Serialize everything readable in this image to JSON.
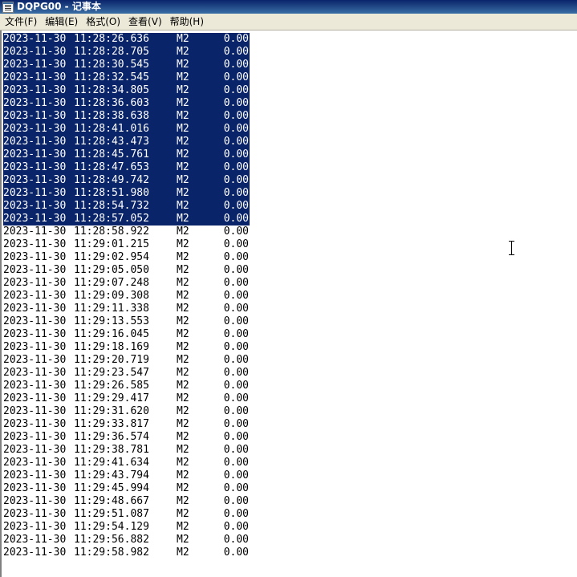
{
  "window": {
    "title": "DQPG00 - 记事本"
  },
  "menu": [
    {
      "label": "文件(F)"
    },
    {
      "label": "编辑(E)"
    },
    {
      "label": "格式(O)"
    },
    {
      "label": "查看(V)"
    },
    {
      "label": "帮助(H)"
    }
  ],
  "editor": {
    "selected_line_count": 15,
    "lines": [
      {
        "date": "2023-11-30",
        "time": "11:28:26.636",
        "unit": "M2",
        "value": "0.00"
      },
      {
        "date": "2023-11-30",
        "time": "11:28:28.705",
        "unit": "M2",
        "value": "0.00"
      },
      {
        "date": "2023-11-30",
        "time": "11:28:30.545",
        "unit": "M2",
        "value": "0.00"
      },
      {
        "date": "2023-11-30",
        "time": "11:28:32.545",
        "unit": "M2",
        "value": "0.00"
      },
      {
        "date": "2023-11-30",
        "time": "11:28:34.805",
        "unit": "M2",
        "value": "0.00"
      },
      {
        "date": "2023-11-30",
        "time": "11:28:36.603",
        "unit": "M2",
        "value": "0.00"
      },
      {
        "date": "2023-11-30",
        "time": "11:28:38.638",
        "unit": "M2",
        "value": "0.00"
      },
      {
        "date": "2023-11-30",
        "time": "11:28:41.016",
        "unit": "M2",
        "value": "0.00"
      },
      {
        "date": "2023-11-30",
        "time": "11:28:43.473",
        "unit": "M2",
        "value": "0.00"
      },
      {
        "date": "2023-11-30",
        "time": "11:28:45.761",
        "unit": "M2",
        "value": "0.00"
      },
      {
        "date": "2023-11-30",
        "time": "11:28:47.653",
        "unit": "M2",
        "value": "0.00"
      },
      {
        "date": "2023-11-30",
        "time": "11:28:49.742",
        "unit": "M2",
        "value": "0.00"
      },
      {
        "date": "2023-11-30",
        "time": "11:28:51.980",
        "unit": "M2",
        "value": "0.00"
      },
      {
        "date": "2023-11-30",
        "time": "11:28:54.732",
        "unit": "M2",
        "value": "0.00"
      },
      {
        "date": "2023-11-30",
        "time": "11:28:57.052",
        "unit": "M2",
        "value": "0.00"
      },
      {
        "date": "2023-11-30",
        "time": "11:28:58.922",
        "unit": "M2",
        "value": "0.00"
      },
      {
        "date": "2023-11-30",
        "time": "11:29:01.215",
        "unit": "M2",
        "value": "0.00"
      },
      {
        "date": "2023-11-30",
        "time": "11:29:02.954",
        "unit": "M2",
        "value": "0.00"
      },
      {
        "date": "2023-11-30",
        "time": "11:29:05.050",
        "unit": "M2",
        "value": "0.00"
      },
      {
        "date": "2023-11-30",
        "time": "11:29:07.248",
        "unit": "M2",
        "value": "0.00"
      },
      {
        "date": "2023-11-30",
        "time": "11:29:09.308",
        "unit": "M2",
        "value": "0.00"
      },
      {
        "date": "2023-11-30",
        "time": "11:29:11.338",
        "unit": "M2",
        "value": "0.00"
      },
      {
        "date": "2023-11-30",
        "time": "11:29:13.553",
        "unit": "M2",
        "value": "0.00"
      },
      {
        "date": "2023-11-30",
        "time": "11:29:16.045",
        "unit": "M2",
        "value": "0.00"
      },
      {
        "date": "2023-11-30",
        "time": "11:29:18.169",
        "unit": "M2",
        "value": "0.00"
      },
      {
        "date": "2023-11-30",
        "time": "11:29:20.719",
        "unit": "M2",
        "value": "0.00"
      },
      {
        "date": "2023-11-30",
        "time": "11:29:23.547",
        "unit": "M2",
        "value": "0.00"
      },
      {
        "date": "2023-11-30",
        "time": "11:29:26.585",
        "unit": "M2",
        "value": "0.00"
      },
      {
        "date": "2023-11-30",
        "time": "11:29:29.417",
        "unit": "M2",
        "value": "0.00"
      },
      {
        "date": "2023-11-30",
        "time": "11:29:31.620",
        "unit": "M2",
        "value": "0.00"
      },
      {
        "date": "2023-11-30",
        "time": "11:29:33.817",
        "unit": "M2",
        "value": "0.00"
      },
      {
        "date": "2023-11-30",
        "time": "11:29:36.574",
        "unit": "M2",
        "value": "0.00"
      },
      {
        "date": "2023-11-30",
        "time": "11:29:38.781",
        "unit": "M2",
        "value": "0.00"
      },
      {
        "date": "2023-11-30",
        "time": "11:29:41.634",
        "unit": "M2",
        "value": "0.00"
      },
      {
        "date": "2023-11-30",
        "time": "11:29:43.794",
        "unit": "M2",
        "value": "0.00"
      },
      {
        "date": "2023-11-30",
        "time": "11:29:45.994",
        "unit": "M2",
        "value": "0.00"
      },
      {
        "date": "2023-11-30",
        "time": "11:29:48.667",
        "unit": "M2",
        "value": "0.00"
      },
      {
        "date": "2023-11-30",
        "time": "11:29:51.087",
        "unit": "M2",
        "value": "0.00"
      },
      {
        "date": "2023-11-30",
        "time": "11:29:54.129",
        "unit": "M2",
        "value": "0.00"
      },
      {
        "date": "2023-11-30",
        "time": "11:29:56.882",
        "unit": "M2",
        "value": "0.00"
      },
      {
        "date": "2023-11-30",
        "time": "11:29:58.982",
        "unit": "M2",
        "value": "0.00"
      }
    ]
  },
  "colors": {
    "selection_background": "#0a246a",
    "selection_text": "#ffffff",
    "titlebar": "#0a246a",
    "menubar": "#ece9d8"
  }
}
